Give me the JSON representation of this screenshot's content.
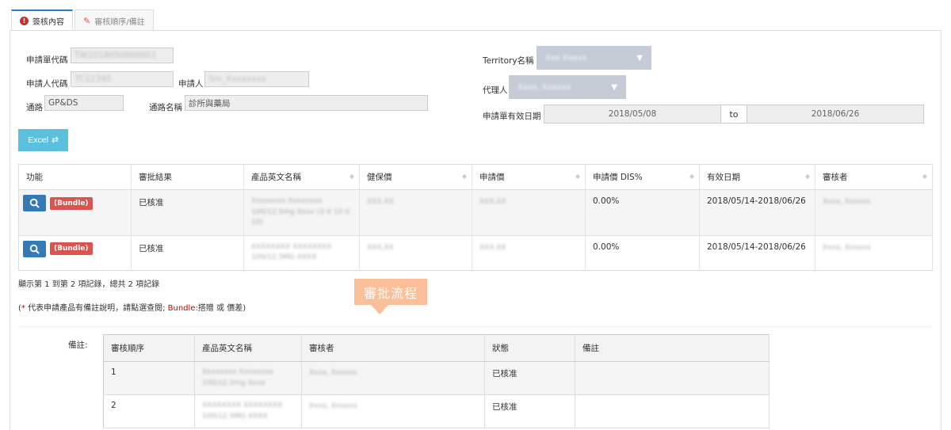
{
  "tabs": [
    {
      "label": "簽核內容",
      "icon": "info-circle-icon",
      "active": true
    },
    {
      "label": "審核順序/備註",
      "icon": "edit-icon",
      "active": false
    }
  ],
  "form": {
    "app_no_label": "申請單代碼",
    "app_no_value": "TW2018050800001",
    "applicant_code_label": "申請人代碼",
    "applicant_code_value": "TC12345",
    "applicant_label": "申請人",
    "applicant_value": "Sm_Xxxxxxxx",
    "channel_label": "通路",
    "channel_value": "GP&DS",
    "channel_name_label": "通路名稱",
    "channel_name_value": "診所與藥局",
    "territory_label": "Territory名稱",
    "territory_value": "Xxx Xxxxx",
    "agent_label": "代理人",
    "agent_value": "Xxxx, Xxxxxx",
    "valid_period_label": "申請單有效日期",
    "valid_from": "2018/05/08",
    "to_label": "to",
    "valid_to": "2018/06/26"
  },
  "excel_button": "Excel",
  "main_table": {
    "headers": [
      "功能",
      "審批結果",
      "產品英文名稱",
      "健保價",
      "申請價",
      "申請價 DIS%",
      "有效日期",
      "審核者"
    ],
    "rows": [
      {
        "badge": "(Bundle)",
        "result": "已核准",
        "product": "Xxxxxxxx Xxxxxxxx 100/12.5mg Xxxx (3 X 10 X 10)",
        "nhi_price": "XXX.XX",
        "apply_price": "XXX.XX",
        "dis": "0.00%",
        "period": "2018/05/14-2018/06/26",
        "reviewer": "Xxxx, Xxxxxx"
      },
      {
        "badge": "(Bundle)",
        "result": "已核准",
        "product": "XXXXXXXX XXXXXXXX 100/12.5MG XXXX",
        "nhi_price": "XXX.XX",
        "apply_price": "XXX.XX",
        "dis": "0.00%",
        "period": "2018/05/14-2018/06/26",
        "reviewer": "Xxxx, Xxxxxx"
      }
    ]
  },
  "summary": "顯示第 1 到第 2 項記錄，總共 2 項記錄",
  "note": {
    "open": "(",
    "star": "*",
    "text1": " 代表申請產品有備註說明，請點選查閱;",
    "bundle": " Bundle:",
    "text2": "搭贈 或 價差)"
  },
  "tooltip": "審批流程",
  "remark_label": "備註:",
  "approval_table": {
    "headers": [
      "審核順序",
      "產品英文名稱",
      "審核者",
      "狀態",
      "備註"
    ],
    "rows": [
      {
        "order": "1",
        "product": "Xxxxxxxx Xxxxxxxx 100/12.5mg Xxxx",
        "reviewer": "Xxxx, Xxxxxx",
        "status": "已核准",
        "remark": ""
      },
      {
        "order": "2",
        "product": "XXXXXXXX XXXXXXXX 100/12.5MG XXXX",
        "reviewer": "Xxxx, Xxxxxx",
        "status": "已核准",
        "remark": ""
      }
    ]
  },
  "colors": {
    "primary": "#337ab7",
    "info": "#5bc0de",
    "danger": "#d9534f",
    "tooltip": "#fbbf9a"
  }
}
